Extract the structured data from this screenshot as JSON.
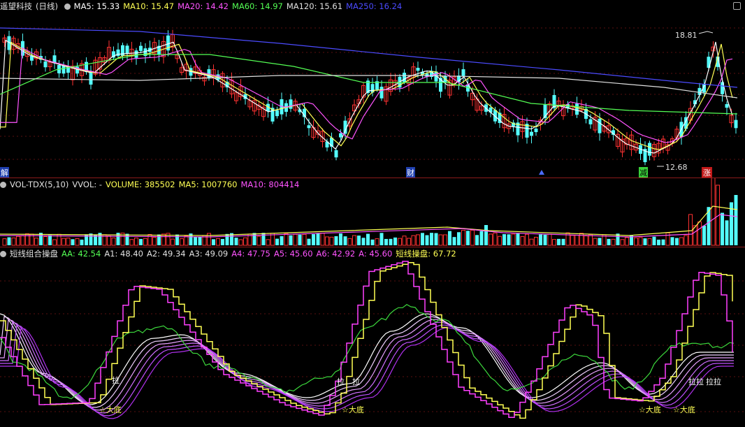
{
  "price_panel": {
    "symbol": "遥望科技",
    "period": "(日线)",
    "indicators": [
      {
        "label": "MA5: 15.33",
        "color": "#ffffff"
      },
      {
        "label": "MA10: 15.47",
        "color": "#ffff54"
      },
      {
        "label": "MA20: 14.42",
        "color": "#ff54ff"
      },
      {
        "label": "MA60: 14.97",
        "color": "#54ff54"
      },
      {
        "label": "MA120: 15.61",
        "color": "#e0e0e0"
      },
      {
        "label": "MA250: 16.24",
        "color": "#4b4bff"
      }
    ],
    "high_label": "18.81",
    "low_label": "12.68",
    "markers": {
      "jie": "解",
      "cai": "财",
      "jian": "减",
      "zhang": "涨"
    }
  },
  "volume_panel": {
    "name": "VOL-TDX(5,10)",
    "fields": [
      {
        "label": "VVOL: -",
        "color": "#e0e0e0"
      },
      {
        "label": "VOLUME: 385502",
        "color": "#ffff54"
      },
      {
        "label": "MA5: 1007760",
        "color": "#ffff54"
      },
      {
        "label": "MA10: 804414",
        "color": "#ff54ff"
      }
    ]
  },
  "indicator_panel": {
    "name": "短线组合操盘",
    "fields": [
      {
        "label": "AA: 42.54",
        "color": "#54ff54"
      },
      {
        "label": "A1: 48.40",
        "color": "#e0e0e0"
      },
      {
        "label": "A2: 49.34",
        "color": "#e0e0e0"
      },
      {
        "label": "A3: 49.09",
        "color": "#e0e0e0"
      },
      {
        "label": "A4: 47.75",
        "color": "#ff54ff"
      },
      {
        "label": "A5: 45.60",
        "color": "#ff54ff"
      },
      {
        "label": "A6: 42.92",
        "color": "#ff54ff"
      },
      {
        "label": "A: 45.60",
        "color": "#ff54ff"
      },
      {
        "label": "短线操盘: 67.72",
        "color": "#ffff54"
      }
    ],
    "signals": {
      "dadi": "☆大底",
      "la": "拉",
      "la2": "拉",
      "la3": "拉",
      "lala": "拉拉",
      "lala2": "拉拉"
    }
  },
  "chart_data": {
    "type": "line",
    "title": "",
    "price_range": [
      12.68,
      18.81
    ],
    "series_names": [
      "MA5",
      "MA10",
      "MA20",
      "MA60",
      "MA120",
      "MA250",
      "VOLUME",
      "AA",
      "短线操盘"
    ],
    "last_values": {
      "MA5": 15.33,
      "MA10": 15.47,
      "MA20": 14.42,
      "MA60": 14.97,
      "MA120": 15.61,
      "MA250": 16.24,
      "VOLUME": 385502,
      "VOL_MA5": 1007760,
      "VOL_MA10": 804414,
      "AA": 42.54,
      "A1": 48.4,
      "A2": 49.34,
      "A3": 49.09,
      "A4": 47.75,
      "A5": 45.6,
      "A6": 42.92,
      "A": 45.6,
      "短线操盘": 67.72
    }
  }
}
